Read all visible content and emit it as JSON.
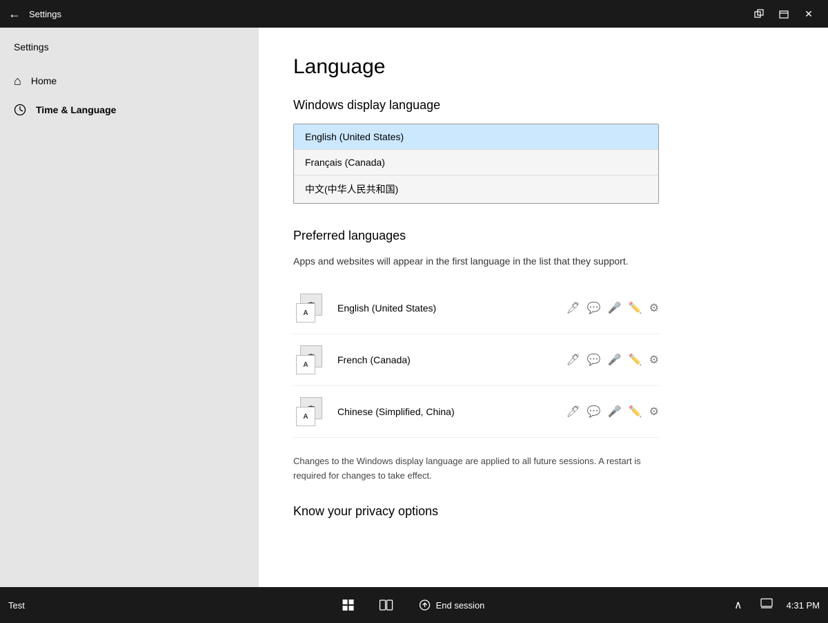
{
  "titlebar": {
    "back_label": "←",
    "title": "Settings",
    "btn_snap": "⊟",
    "btn_maximize": "⤢",
    "btn_close": "✕"
  },
  "sidebar": {
    "header": "Settings",
    "items": [
      {
        "id": "home",
        "label": "Home",
        "icon": "⌂"
      },
      {
        "id": "time-language",
        "label": "Time & Language",
        "icon": "",
        "active": true
      }
    ]
  },
  "main": {
    "page_title": "Language",
    "display_language_section": "Windows display language",
    "display_language_options": [
      {
        "id": "en-us",
        "label": "English (United States)",
        "selected": true
      },
      {
        "id": "fr-ca",
        "label": "Français (Canada)",
        "selected": false
      },
      {
        "id": "zh-cn",
        "label": "中文(中华人民共和国)",
        "selected": false
      }
    ],
    "preferred_section": "Preferred languages",
    "preferred_desc": "Apps and websites will appear in the first language in the list that they support.",
    "preferred_languages": [
      {
        "id": "en-us",
        "label": "English (United States)"
      },
      {
        "id": "fr-ca",
        "label": "French (Canada)"
      },
      {
        "id": "zh-cn",
        "label": "Chinese (Simplified, China)"
      }
    ],
    "note_text": "Changes to the Windows display language are applied to all future sessions. A restart is required for changes to take effect.",
    "privacy_title": "Know your privacy options"
  },
  "taskbar": {
    "start_label": "Test",
    "end_session_label": "End session",
    "time": "4:31 PM"
  }
}
